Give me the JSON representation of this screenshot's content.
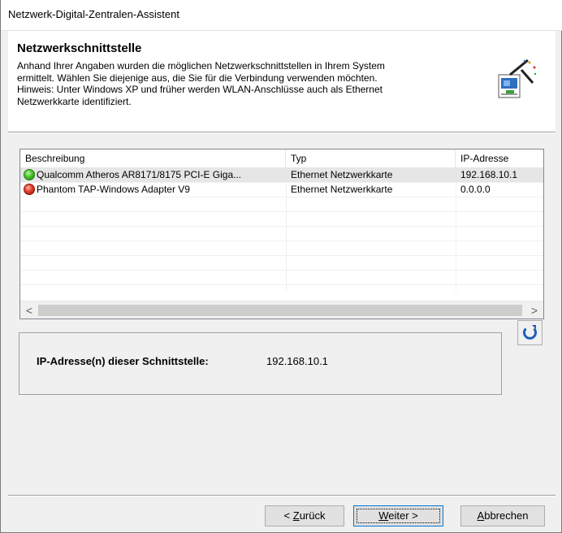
{
  "window": {
    "title": "Netzwerk-Digital-Zentralen-Assistent"
  },
  "header": {
    "title": "Netzwerkschnittstelle",
    "description_lines": [
      "Anhand Ihrer Angaben wurden die möglichen Netzwerkschnittstellen in Ihrem System",
      "ermittelt. Wählen Sie diejenige aus, die Sie für die Verbindung verwenden möchten.",
      "Hinweis: Unter Windows XP und früher werden WLAN-Anschlüsse auch als Ethernet",
      "Netzwerkkarte identifiziert."
    ],
    "icon": "network-wizard-icon"
  },
  "list": {
    "columns": [
      "Beschreibung",
      "Typ",
      "IP-Adresse"
    ],
    "rows": [
      {
        "status": "green",
        "description": "Qualcomm Atheros AR8171/8175 PCI-E Giga...",
        "type": "Ethernet Netzwerkkarte",
        "ip": "192.168.10.1",
        "selected": true
      },
      {
        "status": "red",
        "description": "Phantom TAP-Windows Adapter V9",
        "type": "Ethernet Netzwerkkarte",
        "ip": "0.0.0.0",
        "selected": false
      }
    ],
    "scroll_left": "<",
    "scroll_right": ">"
  },
  "info": {
    "label": "IP-Adresse(n) dieser Schnittstelle:",
    "value": "192.168.10.1"
  },
  "refresh": {
    "icon": "refresh-icon"
  },
  "buttons": {
    "back_prefix": "< ",
    "back_mnemonic": "Z",
    "back_rest": "urück",
    "next_mnemonic": "W",
    "next_rest": "eiter >",
    "cancel_mnemonic": "A",
    "cancel_rest": "bbrechen"
  },
  "colors": {
    "status_green": "#48c42a",
    "status_red": "#e23b2a",
    "accent": "#0078d7"
  }
}
